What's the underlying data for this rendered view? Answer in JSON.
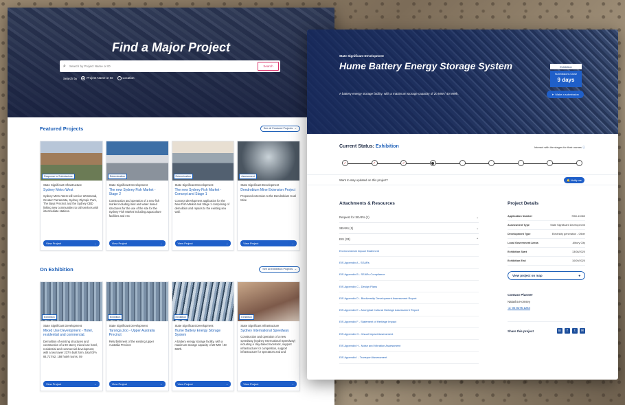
{
  "left": {
    "hero_title": "Find a Major Project",
    "search_placeholder": "Search by Project Name or ID",
    "search_button": "Search",
    "search_by": "Search by",
    "option_name": "Project Name or ID",
    "option_location": "Location",
    "featured": {
      "title": "Featured Projects",
      "see_all": "See all Featured Projects",
      "cards": [
        {
          "badge": "Response to Submissions",
          "type": "State Significant Infrastructure",
          "title": "Sydney Metro West",
          "desc": "Sydney Metro West will service Westmead, Greater Parramatta, Sydney Olympic Park, The Bays Precinct and the Sydney CBD linking new communities to rail services with intermediate stations.",
          "button": "View Project"
        },
        {
          "badge": "Determination",
          "type": "State Significant Development",
          "title": "The new Sydney Fish Market - Stage 2",
          "desc": "Construction and operation of a new fish market including land and water based structures for the use of the site for the Sydney Fish Market including aquaculture facilities and enc",
          "button": "View Project"
        },
        {
          "badge": "Determination",
          "type": "State Significant Development",
          "title": "The new Sydney Fish Market - Concept and Stage 1",
          "desc": "Concept development application for the New Fish Market and Stage 1 comprising of demolition and repairs to the existing sea wall.",
          "button": "View Project"
        },
        {
          "badge": "Assessment",
          "type": "State Significant Development",
          "title": "Dendrobium Mine Extension Project",
          "desc": "Proposed extension to the Dendrobium Coal Mine",
          "button": "View Project"
        }
      ]
    },
    "exhibition": {
      "title": "On Exhibition",
      "see_all": "See all Exhibition Projects",
      "cards": [
        {
          "badge": "Exhibition",
          "type": "State Significant Development",
          "title": "Mixed Use Development - Hotel, residential and commercial.",
          "desc": "Demolition of existing structures and construction of a 80 storey mixed use hotel, residential and commercial development, with a two tower 237m built form, total GFA 84,717m2, 158 hotel rooms, 59",
          "button": "View Project"
        },
        {
          "badge": "Exhibition",
          "type": "State Significant Development",
          "title": "Taronga Zoo - Upper Australia Precinct",
          "desc": "Refurbishment of the existing Upper Australia Precinct",
          "button": "View Project"
        },
        {
          "badge": "Exhibition",
          "type": "State Significant Development",
          "title": "Hume Battery Energy Storage System",
          "desc": "A battery energy storage facility, with a maximum storage capacity of 20 MW / 40 MWh.",
          "button": "View Project"
        },
        {
          "badge": "Exhibition",
          "type": "State Significant Infrastructure",
          "title": "Sydney International Speedway",
          "desc": "Construction and operation of a new speedway (Sydney International Speedway) including a clay-based racetrack, support infrastructure for competition, support infrastructure for spectators and and",
          "button": "View Project"
        }
      ]
    }
  },
  "right": {
    "category": "State Significant Development",
    "title": "Hume Battery Energy Storage System",
    "description": "A battery energy storage facility, with a maximum storage capacity of 20 MW / 40 MWh.",
    "exhibition_label": "Exhibition",
    "submissions_label": "Submissions Close",
    "days": "9 days",
    "make_submission": "Make a submission",
    "status_label": "Current Status:",
    "status_value": "Exhibition",
    "interact_hint": "Interact with the stages for their names",
    "stay_updated": "Want to stay updated on this project?",
    "notify": "Notify me",
    "attachments_title": "Attachments & Resources",
    "accordion": [
      {
        "label": "Request for SEARs (1)",
        "chev": "⌄"
      },
      {
        "label": "SEARs (1)",
        "chev": "⌄"
      },
      {
        "label": "EIS (33)",
        "chev": "⌃"
      }
    ],
    "docs": [
      "Environmental Impact Statement",
      "EIS Appendix A - SEARs",
      "EIS Appendix B - SEARs Compliance",
      "EIS Appendix C - Design Plans",
      "EIS Appendix D - Biodiversity Development Assessment Report",
      "EIS Appendix E - Aboriginal Cultural Heritage Assessment Report",
      "EIS Appendix F - Statement of Heritage Impact",
      "EIS Appendix G - Visual Impact Assessment",
      "EIS Appendix H - Noise and Vibration Assessment",
      "EIS Appendix I - Transport Assessment"
    ],
    "details_title": "Project Details",
    "details": [
      {
        "k": "Application Number",
        "v": "SSD-10460"
      },
      {
        "k": "Assessment Type",
        "v": "State Significant Development"
      },
      {
        "k": "Development Type",
        "v": "Electricity generation - Other"
      },
      {
        "k": "Local Government Areas",
        "v": "Albury City"
      },
      {
        "k": "Exhibition Start",
        "v": "13/08/2020"
      },
      {
        "k": "Exhibition End",
        "v": "10/09/2020"
      }
    ],
    "map_button": "View project on map",
    "planner_title": "Contact Planner",
    "planner_name": "Natasha Homsey",
    "planner_phone": "02 8275 1264",
    "share_title": "Share this project"
  }
}
